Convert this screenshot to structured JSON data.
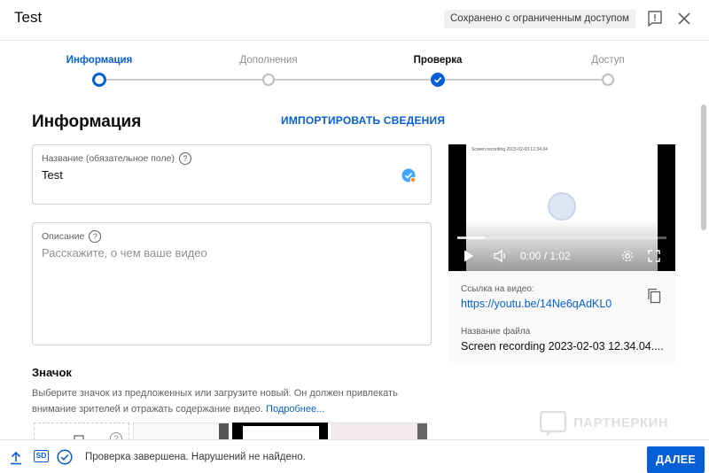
{
  "header": {
    "title": "Test",
    "status_badge": "Сохранено с ограниченным доступом",
    "feedback_icon": "feedback-icon",
    "close_icon": "close-icon"
  },
  "stepper": {
    "steps": [
      {
        "label": "Информация",
        "state": "active"
      },
      {
        "label": "Дополнения",
        "state": "pending"
      },
      {
        "label": "Проверка",
        "state": "done"
      },
      {
        "label": "Доступ",
        "state": "pending"
      }
    ]
  },
  "main": {
    "section_title": "Информация",
    "import_link": "ИМПОРТИРОВАТЬ СВЕДЕНИЯ",
    "title_field": {
      "label": "Название (обязательное поле)",
      "value": "Test"
    },
    "description_field": {
      "label": "Описание",
      "placeholder": "Расскажите, о чем ваше видео"
    },
    "thumbnail": {
      "title": "Значок",
      "description": "Выберите значок из предложенных или загрузите новый. Он должен привлекать внимание зрителей и отражать содержание видео.",
      "more_link": "Подробнее..."
    }
  },
  "video_card": {
    "player_title": "Screen recording 2023-02-03 12.34.04",
    "player_time": "0:00 / 1:02",
    "progress_fraction": 0.13,
    "link_label": "Ссылка на видео:",
    "link_value": "https://youtu.be/14Ne6qAdKL0",
    "filename_label": "Название файла",
    "filename_value": "Screen recording 2023-02-03 12.34.04...."
  },
  "watermark": "ПАРТНЕРКИН",
  "footer": {
    "status": "Проверка завершена. Нарушений не найдено.",
    "sd_badge": "SD",
    "next_button": "ДАЛЕЕ"
  },
  "colors": {
    "accent": "#065fd4",
    "step_inactive": "#bdbdbd",
    "text_secondary": "#606060"
  }
}
